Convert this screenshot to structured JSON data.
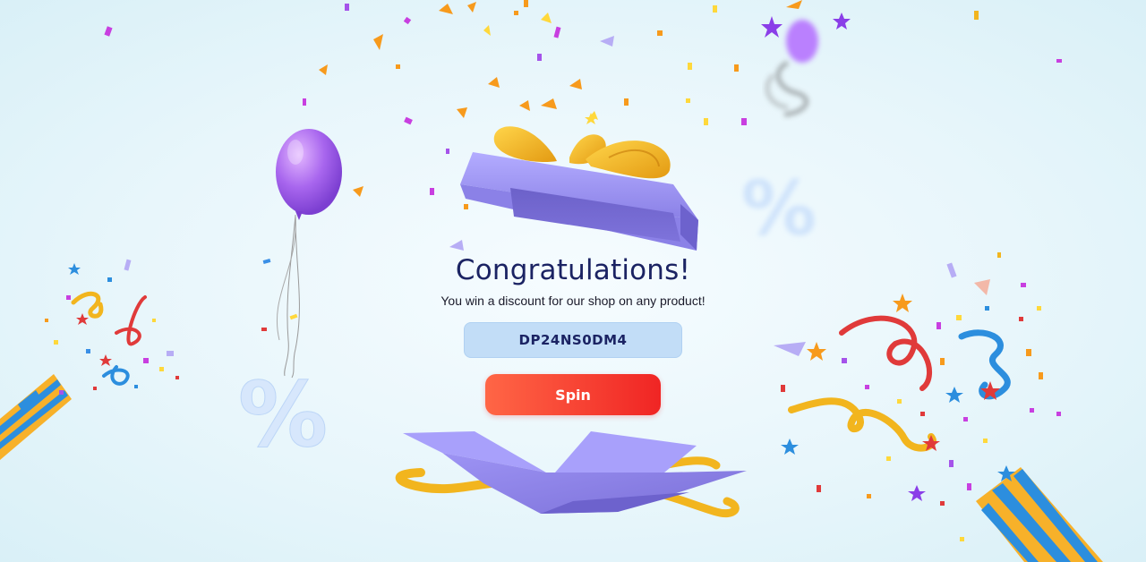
{
  "title": "Congratulations!",
  "subtitle": "You win a discount for our shop on any product!",
  "discount_code": "DP24NS0DM4",
  "spin_label": "Spin",
  "percent_symbol": "%",
  "colors": {
    "title": "#1b2363",
    "code_background": "#c2ddf7",
    "spin_gradient_start": "#ff6646",
    "spin_gradient_end": "#f02524",
    "gift_box": "#8f85ec",
    "ribbon": "#f2b51e",
    "balloon": "#a866ee"
  },
  "icons": [
    "gift-box-lid-icon",
    "gift-box-open-icon",
    "balloon-icon",
    "percent-icon",
    "party-popper-icon",
    "confetti-icon",
    "streamer-icon",
    "star-icon"
  ]
}
